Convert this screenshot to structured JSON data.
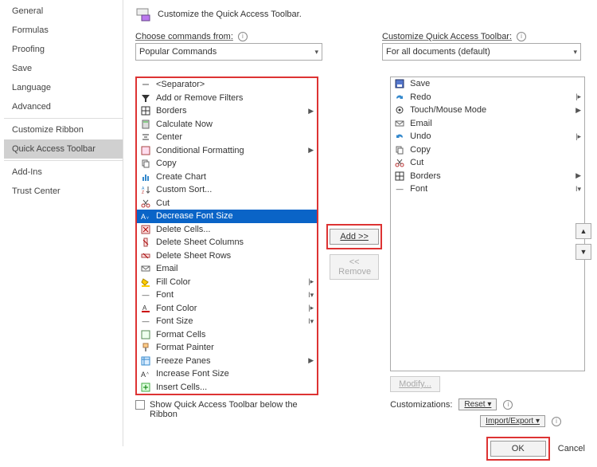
{
  "sidebar": {
    "items": [
      {
        "label": "General"
      },
      {
        "label": "Formulas"
      },
      {
        "label": "Proofing"
      },
      {
        "label": "Save"
      },
      {
        "label": "Language"
      },
      {
        "label": "Advanced"
      },
      {
        "label": "Customize Ribbon"
      },
      {
        "label": "Quick Access Toolbar",
        "selected": true
      },
      {
        "label": "Add-Ins"
      },
      {
        "label": "Trust Center"
      }
    ]
  },
  "header": {
    "title": "Customize the Quick Access Toolbar."
  },
  "choose": {
    "label": "Choose commands from:",
    "value": "Popular Commands"
  },
  "customize": {
    "label": "Customize Quick Access Toolbar:",
    "value": "For all documents (default)"
  },
  "left_list": [
    {
      "icon": "sep",
      "label": "<Separator>"
    },
    {
      "icon": "filter",
      "label": "Add or Remove Filters"
    },
    {
      "icon": "borders",
      "label": "Borders",
      "sub": "▶"
    },
    {
      "icon": "calc",
      "label": "Calculate Now"
    },
    {
      "icon": "center",
      "label": "Center"
    },
    {
      "icon": "condfmt",
      "label": "Conditional Formatting",
      "sub": "▶"
    },
    {
      "icon": "copy",
      "label": "Copy"
    },
    {
      "icon": "chart",
      "label": "Create Chart"
    },
    {
      "icon": "sort",
      "label": "Custom Sort..."
    },
    {
      "icon": "cut",
      "label": "Cut"
    },
    {
      "icon": "decfont",
      "label": "Decrease Font Size",
      "selected": true
    },
    {
      "icon": "delcell",
      "label": "Delete Cells..."
    },
    {
      "icon": "delcol",
      "label": "Delete Sheet Columns"
    },
    {
      "icon": "delrow",
      "label": "Delete Sheet Rows"
    },
    {
      "icon": "email",
      "label": "Email"
    },
    {
      "icon": "fill",
      "label": "Fill Color",
      "sub": "|▸"
    },
    {
      "icon": "font",
      "label": "Font",
      "sub": "I▾"
    },
    {
      "icon": "fontcolor",
      "label": "Font Color",
      "sub": "|▸"
    },
    {
      "icon": "fontsize",
      "label": "Font Size",
      "sub": "I▾"
    },
    {
      "icon": "fcells",
      "label": "Format Cells"
    },
    {
      "icon": "painter",
      "label": "Format Painter"
    },
    {
      "icon": "freeze",
      "label": "Freeze Panes",
      "sub": "▶"
    },
    {
      "icon": "incfont",
      "label": "Increase Font Size"
    },
    {
      "icon": "inscell",
      "label": "Insert Cells..."
    }
  ],
  "right_list": [
    {
      "icon": "save",
      "label": "Save"
    },
    {
      "icon": "redo",
      "label": "Redo",
      "sub": "|▸"
    },
    {
      "icon": "touch",
      "label": "Touch/Mouse Mode",
      "sub": "▶"
    },
    {
      "icon": "email",
      "label": "Email"
    },
    {
      "icon": "undo",
      "label": "Undo",
      "sub": "|▸"
    },
    {
      "icon": "copy",
      "label": "Copy"
    },
    {
      "icon": "cut",
      "label": "Cut"
    },
    {
      "icon": "borders",
      "label": "Borders",
      "sub": "▶"
    },
    {
      "icon": "font",
      "label": "Font",
      "sub": "I▾"
    }
  ],
  "buttons": {
    "add": "Add >>",
    "remove": "<< Remove",
    "modify": "Modify...",
    "reset": "Reset ▾",
    "importexport": "Import/Export ▾",
    "ok": "OK",
    "cancel": "Cancel"
  },
  "customizations_label": "Customizations:",
  "show_below": "Show Quick Access Toolbar below the Ribbon"
}
